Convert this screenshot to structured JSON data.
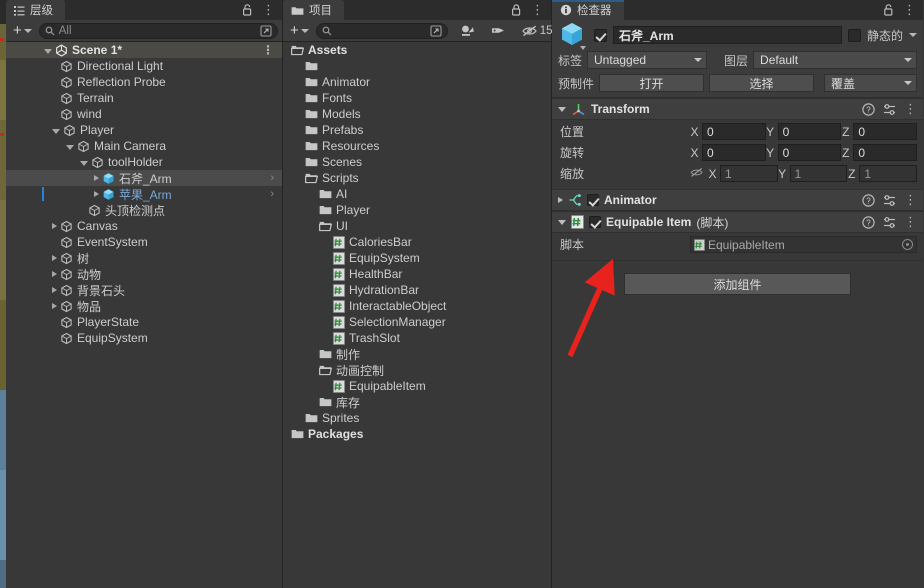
{
  "hierarchy": {
    "tab_label": "层级",
    "tab_icon": "hierarchy-icon",
    "lock_icon": "lock-icon",
    "menu_icon": "kebab-menu-icon",
    "add_label": "+",
    "search_placeholder": "All",
    "search_value": "",
    "search_icon": "search-icon",
    "expand_icon": "expand-window-icon",
    "scene": {
      "label": "Scene 1*",
      "icon": "unity-scene-icon"
    },
    "items": [
      {
        "label": "Directional Light",
        "depth": 2,
        "arrow": "none",
        "icon": "gameobject-icon"
      },
      {
        "label": "Reflection Probe",
        "depth": 2,
        "arrow": "none",
        "icon": "gameobject-icon"
      },
      {
        "label": "Terrain",
        "depth": 2,
        "arrow": "none",
        "icon": "gameobject-icon"
      },
      {
        "label": "wind",
        "depth": 2,
        "arrow": "none",
        "icon": "gameobject-icon"
      },
      {
        "label": "Player",
        "depth": 2,
        "arrow": "open",
        "icon": "gameobject-icon"
      },
      {
        "label": "Main Camera",
        "depth": 3,
        "arrow": "open",
        "icon": "gameobject-icon"
      },
      {
        "label": "toolHolder",
        "depth": 4,
        "arrow": "open",
        "icon": "gameobject-icon"
      },
      {
        "label": "石斧_Arm",
        "depth": 5,
        "arrow": "closed",
        "icon": "prefab-icon",
        "selected": true,
        "chevron": "›"
      },
      {
        "label": "苹果_Arm",
        "depth": 5,
        "arrow": "closed",
        "icon": "prefab-icon",
        "prefab": true,
        "marker": true,
        "chevron": "›"
      },
      {
        "label": "头顶检测点",
        "depth": 4,
        "arrow": "none",
        "icon": "gameobject-icon"
      },
      {
        "label": "Canvas",
        "depth": 2,
        "arrow": "closed",
        "icon": "gameobject-icon"
      },
      {
        "label": "EventSystem",
        "depth": 2,
        "arrow": "none",
        "icon": "gameobject-icon"
      },
      {
        "label": "树",
        "depth": 2,
        "arrow": "closed",
        "icon": "gameobject-icon"
      },
      {
        "label": "动物",
        "depth": 2,
        "arrow": "closed",
        "icon": "gameobject-icon"
      },
      {
        "label": "背景石头",
        "depth": 2,
        "arrow": "closed",
        "icon": "gameobject-icon"
      },
      {
        "label": "物品",
        "depth": 2,
        "arrow": "closed",
        "icon": "gameobject-icon"
      },
      {
        "label": "PlayerState",
        "depth": 2,
        "arrow": "none",
        "icon": "gameobject-icon"
      },
      {
        "label": "EquipSystem",
        "depth": 2,
        "arrow": "none",
        "icon": "gameobject-icon"
      }
    ]
  },
  "project": {
    "tab_label": "项目",
    "tab_icon": "folder-icon",
    "lock_icon": "lock-icon",
    "menu_icon": "kebab-menu-icon",
    "add_label": "+",
    "search_placeholder": "",
    "search_value": "",
    "search_icon": "search-icon",
    "expand_icon": "expand-window-icon",
    "filter_type_icon": "search-by-type-icon",
    "filter_label_icon": "search-by-label-icon",
    "hidden_icon": "hidden-items-icon",
    "hidden_count": "15",
    "items": [
      {
        "label": "Assets",
        "depth": 0,
        "arrow": "open",
        "icon": "folder-open-icon",
        "bold": true
      },
      {
        "label": "",
        "depth": 1,
        "arrow": "closed",
        "icon": "folder-icon"
      },
      {
        "label": "Animator",
        "depth": 1,
        "arrow": "closed",
        "icon": "folder-icon"
      },
      {
        "label": "Fonts",
        "depth": 1,
        "arrow": "closed",
        "icon": "folder-icon"
      },
      {
        "label": "Models",
        "depth": 1,
        "arrow": "closed",
        "icon": "folder-icon"
      },
      {
        "label": "Prefabs",
        "depth": 1,
        "arrow": "closed",
        "icon": "folder-icon"
      },
      {
        "label": "Resources",
        "depth": 1,
        "arrow": "closed",
        "icon": "folder-icon"
      },
      {
        "label": "Scenes",
        "depth": 1,
        "arrow": "closed",
        "icon": "folder-icon"
      },
      {
        "label": "Scripts",
        "depth": 1,
        "arrow": "open",
        "icon": "folder-open-icon"
      },
      {
        "label": "AI",
        "depth": 2,
        "arrow": "closed",
        "icon": "folder-icon"
      },
      {
        "label": "Player",
        "depth": 2,
        "arrow": "closed",
        "icon": "folder-icon"
      },
      {
        "label": "UI",
        "depth": 2,
        "arrow": "open",
        "icon": "folder-open-icon"
      },
      {
        "label": "CaloriesBar",
        "depth": 3,
        "arrow": "none",
        "icon": "csharp-script-icon"
      },
      {
        "label": "EquipSystem",
        "depth": 3,
        "arrow": "none",
        "icon": "csharp-script-icon"
      },
      {
        "label": "HealthBar",
        "depth": 3,
        "arrow": "none",
        "icon": "csharp-script-icon"
      },
      {
        "label": "HydrationBar",
        "depth": 3,
        "arrow": "none",
        "icon": "csharp-script-icon"
      },
      {
        "label": "InteractableObject",
        "depth": 3,
        "arrow": "none",
        "icon": "csharp-script-icon"
      },
      {
        "label": "SelectionManager",
        "depth": 3,
        "arrow": "none",
        "icon": "csharp-script-icon"
      },
      {
        "label": "TrashSlot",
        "depth": 3,
        "arrow": "none",
        "icon": "csharp-script-icon"
      },
      {
        "label": "制作",
        "depth": 2,
        "arrow": "closed",
        "icon": "folder-icon"
      },
      {
        "label": "动画控制",
        "depth": 2,
        "arrow": "open",
        "icon": "folder-open-icon"
      },
      {
        "label": "EquipableItem",
        "depth": 3,
        "arrow": "none",
        "icon": "csharp-script-icon"
      },
      {
        "label": "库存",
        "depth": 2,
        "arrow": "closed",
        "icon": "folder-icon"
      },
      {
        "label": "Sprites",
        "depth": 1,
        "arrow": "closed",
        "icon": "folder-icon"
      },
      {
        "label": "Packages",
        "depth": 0,
        "arrow": "closed",
        "icon": "folder-icon",
        "bold": true
      }
    ]
  },
  "inspector": {
    "tab_label": "检查器",
    "tab_icon": "info-icon",
    "lock_icon": "lock-icon",
    "menu_icon": "kebab-menu-icon",
    "object_icon": "prefab-cube-icon",
    "enabled": true,
    "name_value": "石斧_Arm",
    "static_label": "静态的",
    "static_checked": false,
    "tag_label": "标签",
    "tag_value": "Untagged",
    "layer_label": "图层",
    "layer_value": "Default",
    "prefab_label": "预制件",
    "prefab_open": "打开",
    "prefab_select": "选择",
    "prefab_overrides": "覆盖",
    "transform": {
      "title": "Transform",
      "icon": "transform-icon",
      "help_icon": "help-icon",
      "preset_icon": "preset-icon",
      "menu_icon": "kebab-menu-icon",
      "rows": [
        {
          "name": "位置",
          "x": "0",
          "y": "0",
          "z": "0",
          "dim": false,
          "lock_icon": null
        },
        {
          "name": "旋转",
          "x": "0",
          "y": "0",
          "z": "0",
          "dim": false,
          "lock_icon": null
        },
        {
          "name": "缩放",
          "x": "1",
          "y": "1",
          "z": "1",
          "dim": true,
          "lock_icon": "constrain-off-icon"
        }
      ],
      "axes": [
        "X",
        "Y",
        "Z"
      ]
    },
    "animator": {
      "title": "Animator",
      "icon": "animator-icon",
      "enabled": true,
      "expanded": false,
      "help_icon": "help-icon",
      "preset_icon": "preset-icon",
      "menu_icon": "kebab-menu-icon"
    },
    "equipable": {
      "title": "Equipable Item",
      "suffix": "(脚本)",
      "icon": "csharp-script-icon",
      "enabled": true,
      "expanded": true,
      "help_icon": "help-icon",
      "preset_icon": "preset-icon",
      "menu_icon": "kebab-menu-icon",
      "script_label": "脚本",
      "script_value": "EquipableItem",
      "script_icon": "csharp-script-icon",
      "picker_icon": "object-picker-icon"
    },
    "add_component_label": "添加组件"
  },
  "annotation": {
    "arrow_color": "#e8221c",
    "arrow_name": "red-pointer-arrow"
  }
}
